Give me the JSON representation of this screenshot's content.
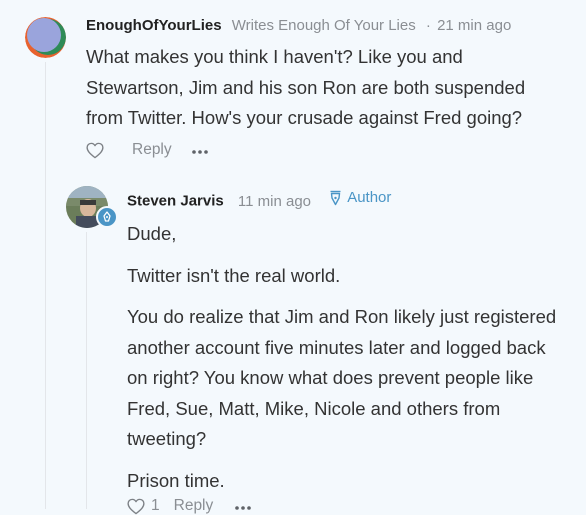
{
  "comment1": {
    "author": "EnoughOfYourLies",
    "tagline": "Writes Enough Of Your Lies",
    "separator": "·",
    "time": "21 min ago",
    "body": "What makes you think I haven't? Like you and Stewartson, Jim and his son Ron are both suspended from Twitter. How's your crusade against Fred going?",
    "reply_label": "Reply",
    "like_icon": "heart-icon",
    "more_icon": "more-dots-icon"
  },
  "comment2": {
    "author": "Steven Jarvis",
    "time": "11 min ago",
    "badge": "Author",
    "badge_icon": "pen-nib-icon",
    "paragraphs": [
      "Dude,",
      "Twitter isn't the real world.",
      "You do realize that Jim and Ron likely just registered another account five minutes later and logged back on right? You know what does prevent people like Fred, Sue, Matt, Mike, Nicole and others from tweeting?",
      "Prison time."
    ],
    "like_count": "1",
    "reply_label": "Reply",
    "accent_color": "#4a95c6"
  }
}
